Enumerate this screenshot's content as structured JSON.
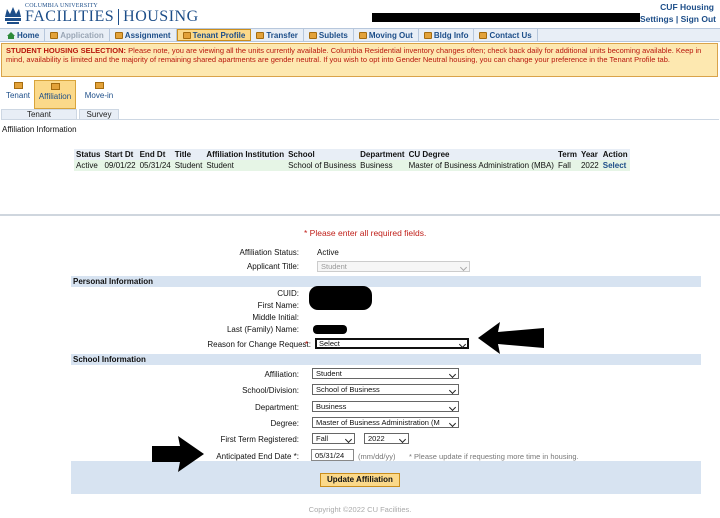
{
  "header": {
    "logo_small": "COLUMBIA UNIVERSITY",
    "logo_big_left": "FACILITIES",
    "logo_big_right": "HOUSING",
    "user_label": "CUF Housing",
    "settings_link": "Settings",
    "signout_link": "Sign Out",
    "separator": " | "
  },
  "nav": {
    "home": "Home",
    "application": "Application",
    "assignment": "Assignment",
    "tenant_profile": "Tenant Profile",
    "transfer": "Transfer",
    "sublets": "Sublets",
    "moving_out": "Moving Out",
    "bldg_info": "Bldg Info",
    "contact_us": "Contact Us"
  },
  "alert": {
    "lead": "STUDENT HOUSING SELECTION:",
    "text": " Please note, you are viewing all the units currently available. Columbia Residential inventory changes often; check back daily for additional units becoming available. Keep in mind, availability is limited and the majority of remaining shared apartments are gender neutral. If you wish to opt into Gender Neutral housing, you can change your preference in the Tenant Profile tab."
  },
  "subtabs": {
    "tenant": "Tenant",
    "affiliation": "Affiliation",
    "movein": "Move-in",
    "group_tenant": "Tenant",
    "group_survey": "Survey"
  },
  "page_title": "Affiliation Information",
  "table": {
    "headers": [
      "Status",
      "Start Dt",
      "End Dt",
      "Title",
      "Affiliation Institution",
      "School",
      "Department",
      "CU Degree",
      "Term",
      "Year",
      "Action"
    ],
    "row": [
      "Active",
      "09/01/22",
      "05/31/24",
      "Student",
      "Student",
      "School of Business",
      "Business",
      "Master of Business Administration (MBA)",
      "Fall",
      "2022",
      "Select"
    ]
  },
  "form": {
    "required_note": "* Please enter all required fields.",
    "affiliation_status_label": "Affiliation Status:",
    "affiliation_status_value": "Active",
    "applicant_title_label": "Applicant Title:",
    "applicant_title_value": "Student",
    "personal_section": "Personal Information",
    "cuid_label": "CUID:",
    "first_name_label": "First Name:",
    "middle_initial_label": "Middle Initial:",
    "last_name_label": "Last (Family) Name:",
    "reason_label": "Reason for Change Request:",
    "reason_req": "*",
    "reason_value": "Select",
    "school_section": "School Information",
    "affiliation_label": "Affiliation:",
    "affiliation_value": "Student",
    "school_label": "School/Division:",
    "school_value": "School of Business",
    "department_label": "Department:",
    "department_value": "Business",
    "degree_label": "Degree:",
    "degree_value": "Master of Business Administration (M",
    "first_term_label": "First Term Registered:",
    "first_term_value": "Fall",
    "first_year_value": "2022",
    "end_date_label": "Anticipated End Date *:",
    "end_date_value": "05/31/24",
    "end_date_format": "(mm/dd/yy)",
    "end_date_hint": "* Please update if requesting more time in housing.",
    "submit_label": "Update Affiliation"
  },
  "footer": "Copyright ©2022 CU Facilities.",
  "icons": [
    "crown-logo-icon",
    "home-icon",
    "folder-icon",
    "arrow-right-icon",
    "arrow-left-icon"
  ]
}
